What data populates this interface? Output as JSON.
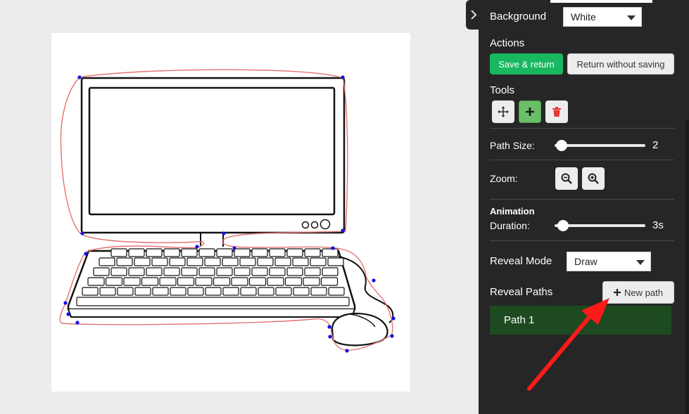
{
  "canvas": {
    "illustration": "computer-keyboard-mouse-drawing"
  },
  "panel": {
    "background": {
      "label": "Background",
      "selected": "White"
    },
    "actions": {
      "label": "Actions",
      "save_label": "Save & return",
      "return_label": "Return without saving"
    },
    "tools": {
      "label": "Tools",
      "items": [
        "move-icon",
        "add-point-icon",
        "trash-icon"
      ],
      "active": "add-point-icon"
    },
    "path_size": {
      "label": "Path Size:",
      "value": 2,
      "min": 1,
      "max": 50
    },
    "zoom": {
      "label": "Zoom:"
    },
    "animation": {
      "label_line1": "Animation",
      "label_line2": "Duration:",
      "value": 3,
      "unit": "s",
      "display": "3s",
      "min": 1,
      "max": 60
    },
    "reveal_mode": {
      "label": "Reveal Mode",
      "selected": "Draw"
    },
    "reveal_paths": {
      "label": "Reveal Paths",
      "new_path_label": "New path",
      "paths": [
        "Path 1"
      ]
    }
  },
  "colors": {
    "panel_bg": "#262626",
    "accent_green": "#19b760",
    "path_item_bg": "#1e4a22",
    "path_stroke": "#e57373",
    "point": "#1010ee",
    "arrow": "#ff1a1a"
  }
}
